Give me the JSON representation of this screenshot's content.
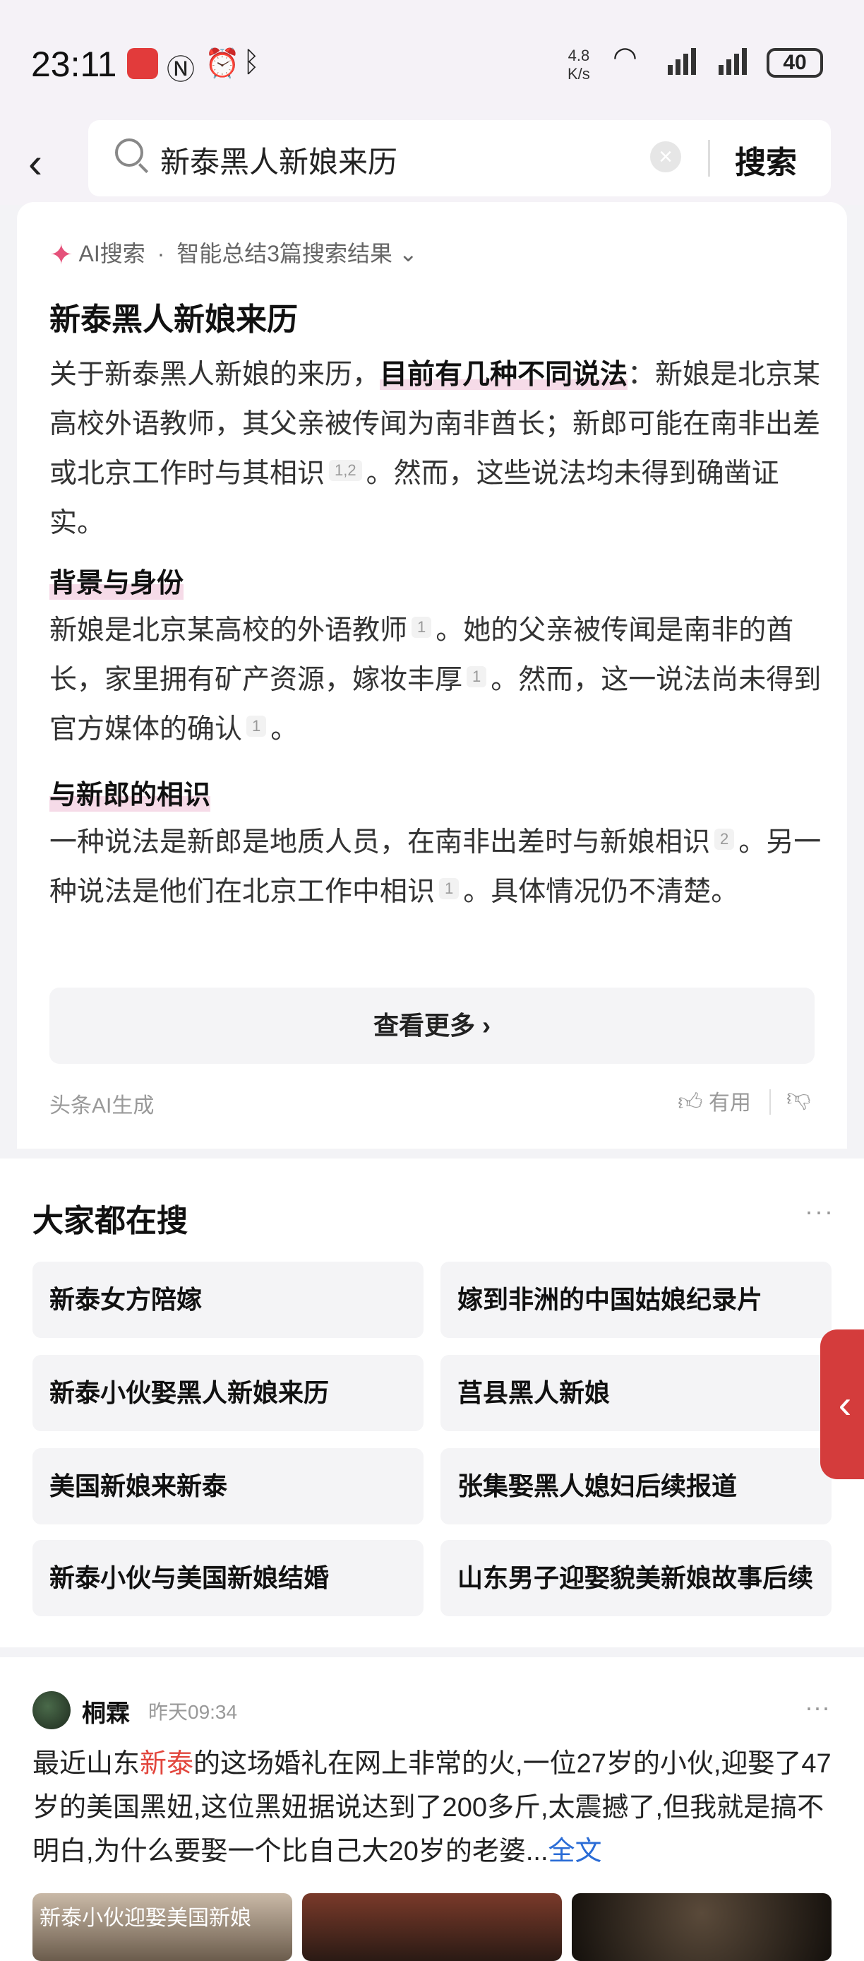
{
  "status_bar": {
    "time": "23:11",
    "net_speed_value": "4.8",
    "net_speed_unit": "K/s",
    "battery": "40",
    "icons": [
      "huawei-icon",
      "nfc-icon",
      "alarm-icon",
      "bluetooth-icon",
      "wifi-icon",
      "signal-icon",
      "signal-icon-2",
      "battery-icon"
    ]
  },
  "search": {
    "query": "新泰黑人新娘来历",
    "button": "搜索"
  },
  "ai_summary": {
    "label": "AI搜索",
    "sep": "·",
    "summary_label": "智能总结3篇搜索结果",
    "title": "新泰黑人新娘来历",
    "p1_a": "关于新泰黑人新娘的来历，",
    "p1_b": "目前有几种不同说法",
    "p1_c": "：新娘是北京某高校外语教师，其父亲被传闻为南非酋长；新郎可能在南非出差或北京工作时与其相识",
    "p1_ref": "1,2",
    "p1_d": "。然而，这些说法均未得到确凿证实。",
    "h2": "背景与身份",
    "p2_a": "新娘是北京某高校的外语教师",
    "p2_ref1": "1",
    "p2_b": "。她的父亲被传闻是南非的酋长，家里拥有矿产资源，嫁妆丰厚",
    "p2_ref2": "1",
    "p2_c": "。然而，这一说法尚未得到官方媒体的确认",
    "p2_ref3": "1",
    "p2_d": "。",
    "h3": "与新郎的相识",
    "p3_a": "一种说法是新郎是地质人员，在南非出差时与新娘相识",
    "p3_ref1": "2",
    "p3_b": "。另一种说法是他们在北京工作中相识",
    "p3_ref2": "1",
    "p3_c": "。具体情况仍不清楚。",
    "more": "查看更多 ›",
    "footer": "头条AI生成",
    "useful": "有用"
  },
  "hot": {
    "title": "大家都在搜",
    "items": [
      "新泰女方陪嫁",
      "嫁到非洲的中国姑娘纪录片",
      "新泰小伙娶黑人新娘来历",
      "莒县黑人新娘",
      "美国新娘来新泰",
      "张集娶黑人媳妇后续报道",
      "新泰小伙与美国新娘结婚",
      "山东男子迎娶貌美新娘故事后续"
    ]
  },
  "post": {
    "author": "桐霖",
    "time": "昨天09:34",
    "text_a": "最近山东",
    "text_hl": "新泰",
    "text_b": "的这场婚礼在网上非常的火,一位27岁的小伙,迎娶了47岁的美国黑妞,这位黑妞据说达到了200多斤,太震撼了,但我就是搞不明白,为什么要娶一个比自己大20岁的老婆...",
    "full_text": "全文",
    "image_caption": "新泰小伙迎娶美国新娘"
  }
}
